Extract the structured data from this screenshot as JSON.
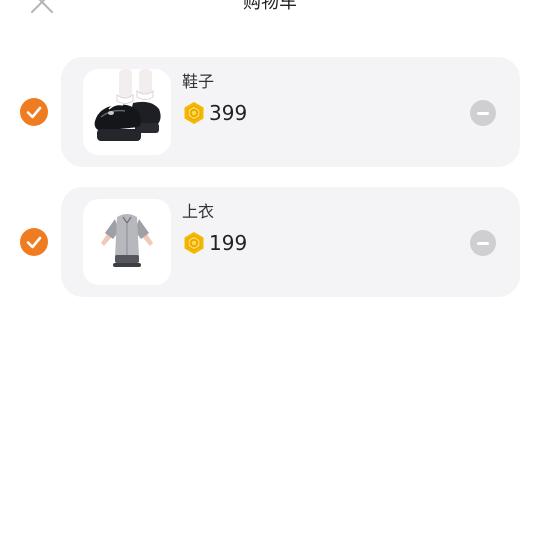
{
  "header": {
    "title": "购物车",
    "close_icon": "close-icon"
  },
  "colors": {
    "accent": "#f07c22",
    "card_background": "#f4f4f7",
    "coin": "#f5b800",
    "remove_button": "#cfcfd3"
  },
  "cart": {
    "items": [
      {
        "name": "鞋子",
        "price": "399",
        "selected": true,
        "image_icon": "black-mary-jane-platform-shoes"
      },
      {
        "name": "上衣",
        "price": "199",
        "selected": true,
        "image_icon": "gray-short-sleeve-shirt"
      }
    ]
  }
}
